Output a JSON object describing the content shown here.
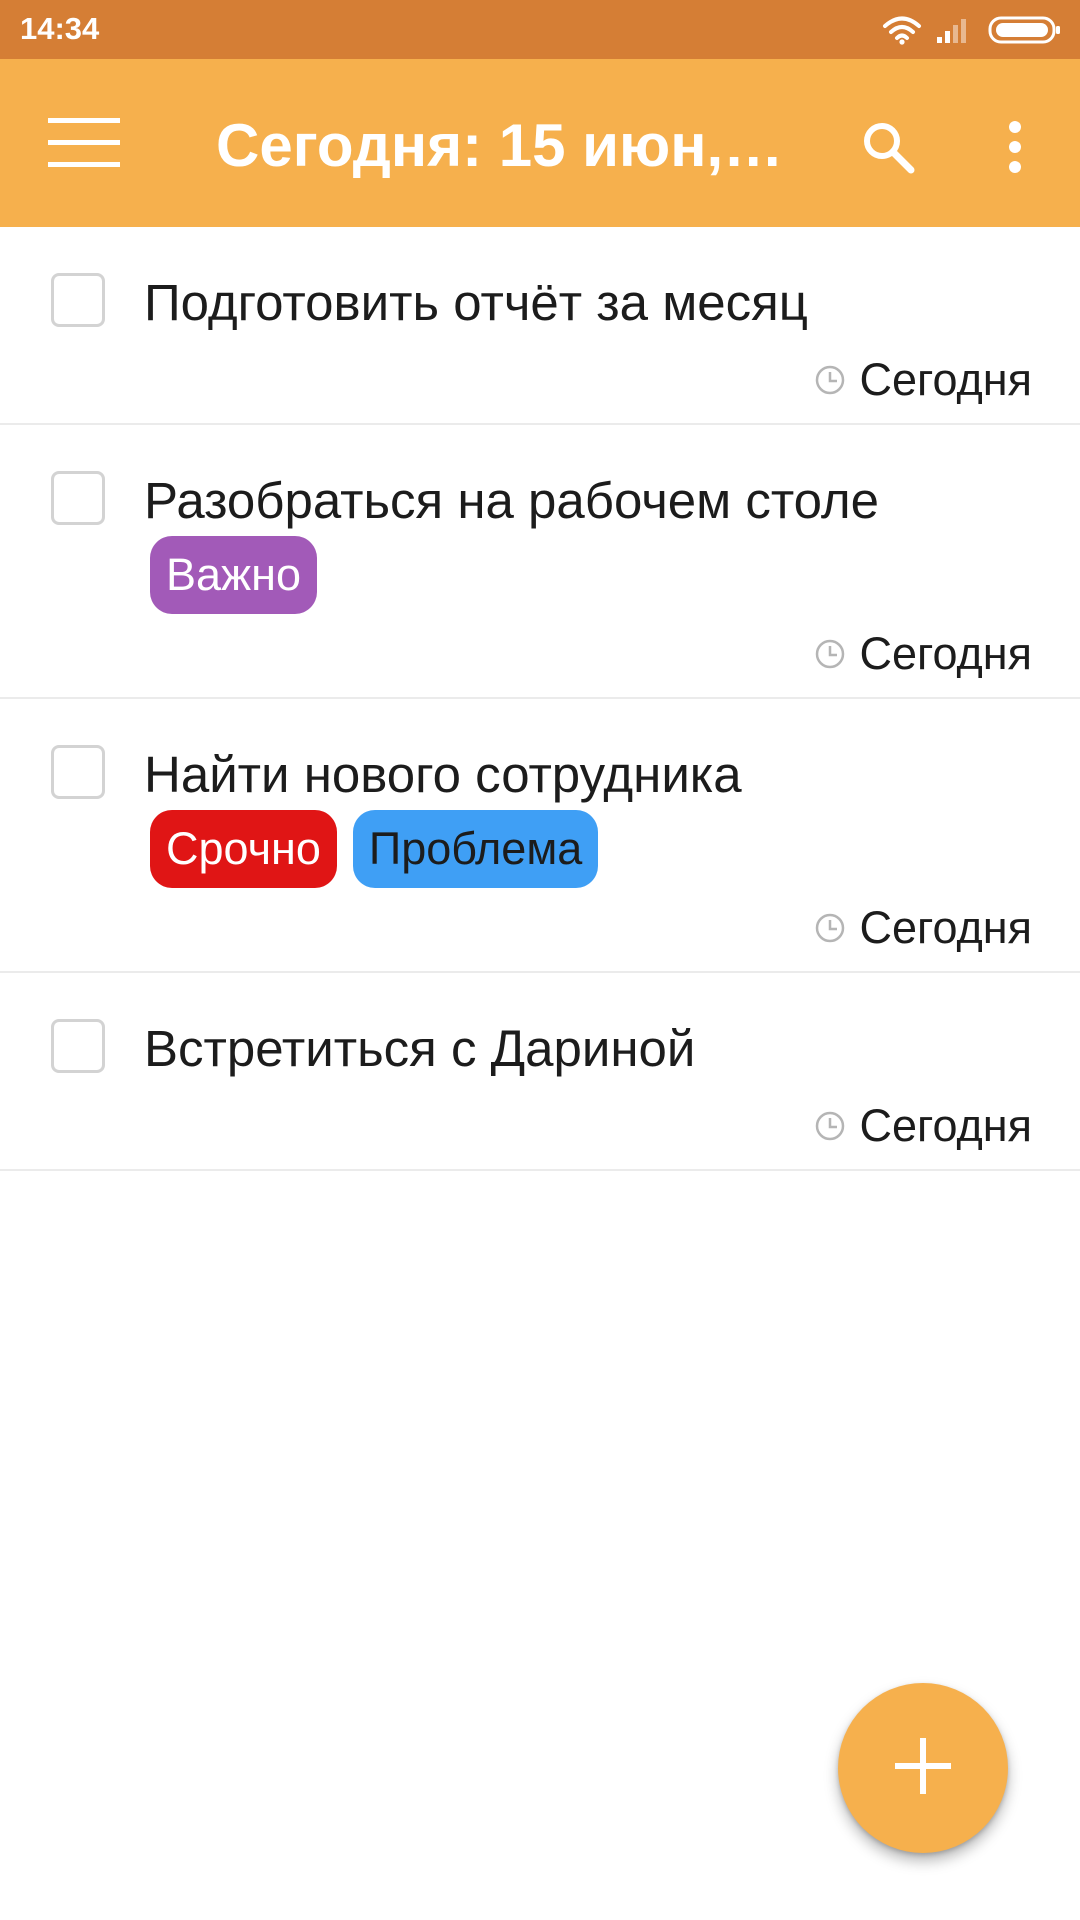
{
  "status_bar": {
    "time": "14:34",
    "icons": [
      "wifi-icon",
      "signal-icon",
      "battery-icon"
    ]
  },
  "app_bar": {
    "title": "Сегодня: 15 июн,…",
    "icons": [
      "menu-icon",
      "search-icon",
      "more-vert-icon"
    ]
  },
  "colors": {
    "status_bar": "#d57e35",
    "app_bar": "#f6b04d",
    "fab": "#f6b04d",
    "tag_important": "#a25ab8",
    "tag_urgent": "#e01515",
    "tag_problem": "#3f9ff5"
  },
  "tasks": [
    {
      "title": "Подготовить отчёт за месяц",
      "due": "Сегодня",
      "checked": false,
      "tags": []
    },
    {
      "title": "Разобраться на рабочем столе",
      "due": "Сегодня",
      "checked": false,
      "tags": [
        {
          "label": "Важно",
          "color": "#a25ab8",
          "text_color": "#ffffff"
        }
      ]
    },
    {
      "title": "Найти нового сотрудника",
      "due": "Сегодня",
      "checked": false,
      "tags": [
        {
          "label": "Срочно",
          "color": "#e01515",
          "text_color": "#ffffff"
        },
        {
          "label": "Проблема",
          "color": "#3f9ff5",
          "text_color": "#1c1c1c"
        }
      ]
    },
    {
      "title": "Встретиться с Дариной",
      "due": "Сегодня",
      "checked": false,
      "tags": []
    }
  ],
  "fab": {
    "icon": "plus-icon"
  }
}
